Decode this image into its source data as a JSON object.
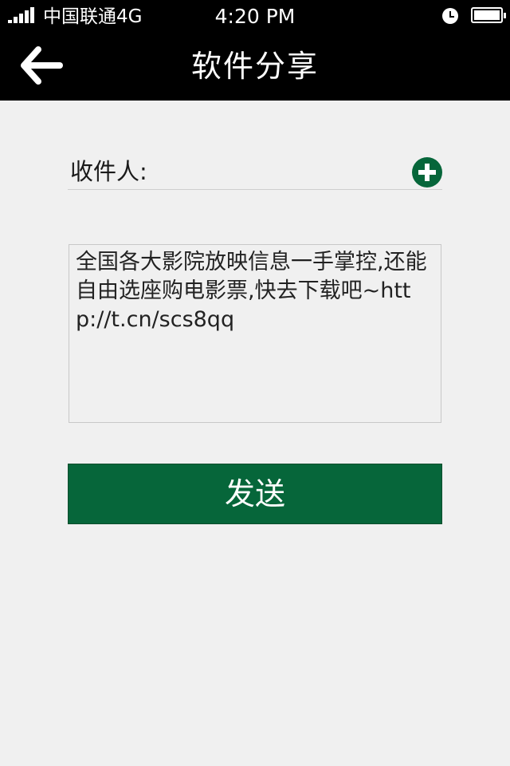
{
  "status_bar": {
    "carrier": "中国联通4G",
    "time": "4:20 PM"
  },
  "nav": {
    "title": "软件分享"
  },
  "recipient": {
    "label": "收件人:",
    "value": ""
  },
  "message": {
    "text": "全国各大影院放映信息一手掌控,还能自由选座购电影票,快去下载吧~http://t.cn/scs8qq"
  },
  "send_button": {
    "label": "发送"
  },
  "colors": {
    "brand_green": "#06663a",
    "bar_black": "#000000",
    "background": "#f0f0f0"
  },
  "icons": [
    "signal-icon",
    "clock-icon",
    "battery-icon",
    "back-arrow-icon",
    "add-contact-icon"
  ]
}
